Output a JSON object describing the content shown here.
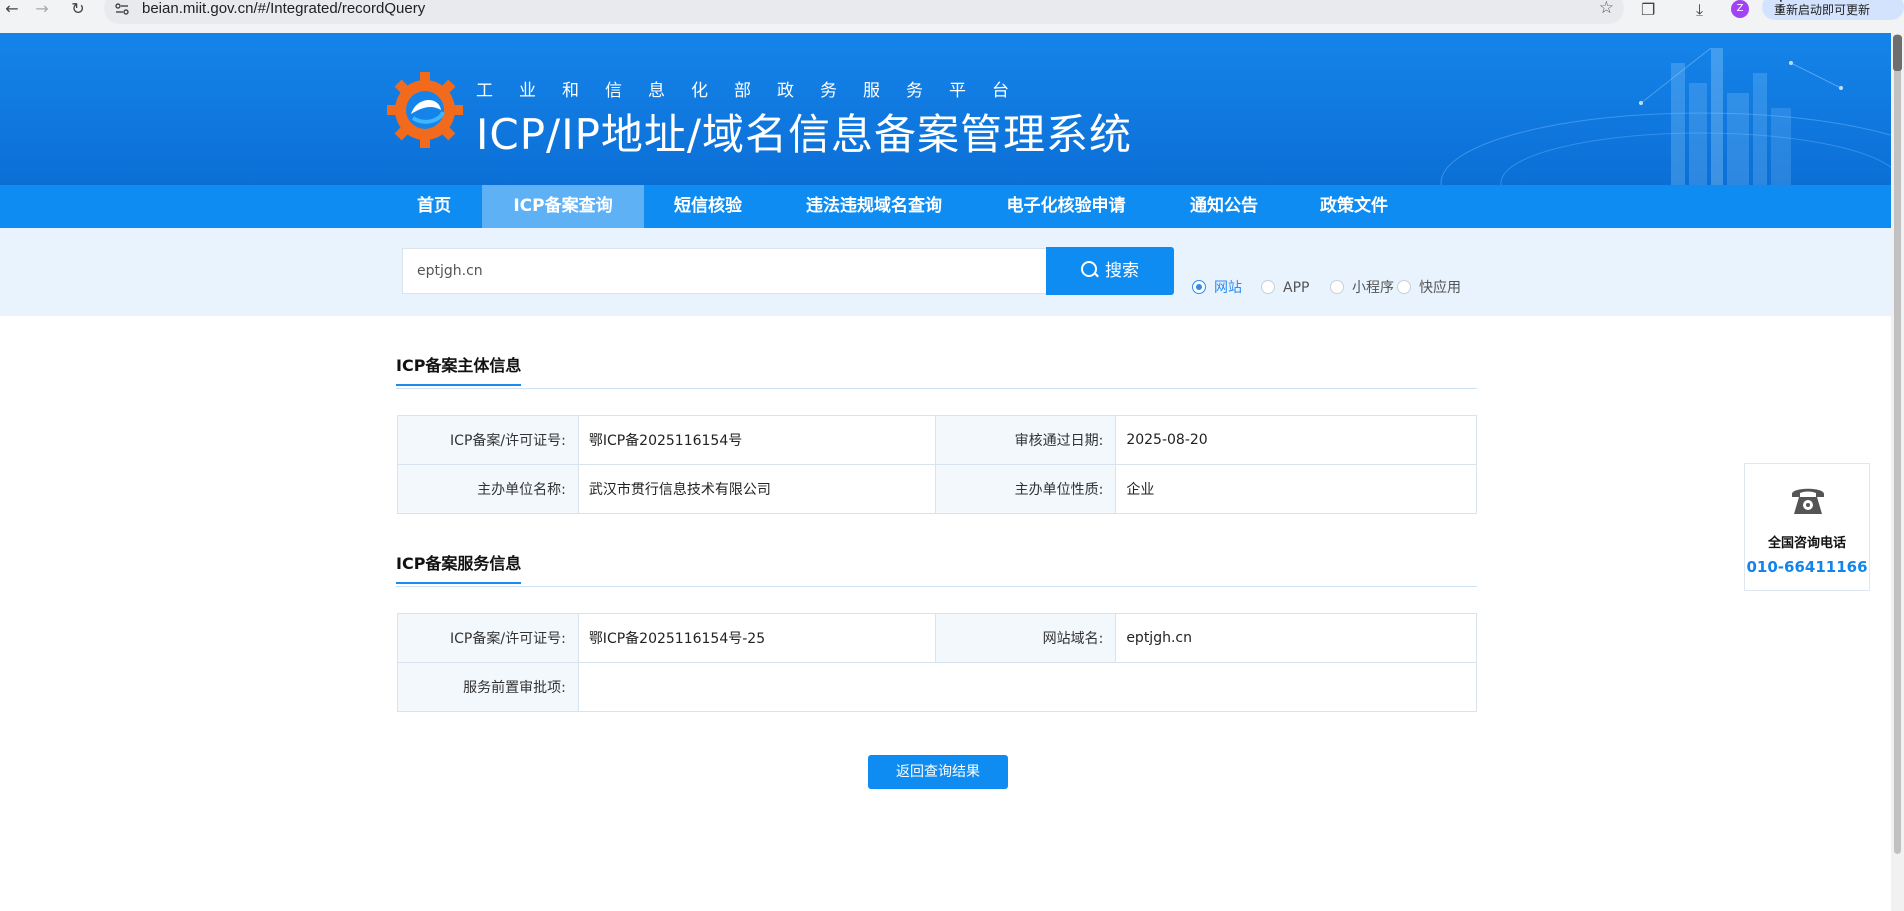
{
  "browser": {
    "url": "beian.miit.gov.cn/#/Integrated/recordQuery",
    "update_label": "重新启动即可更新",
    "avatar_letter": "Z"
  },
  "header": {
    "subtitle": "工业和信息化部政务服务平台",
    "title": "ICP/IP地址/域名信息备案管理系统"
  },
  "nav": {
    "items": [
      "首页",
      "ICP备案查询",
      "短信核验",
      "违法违规域名查询",
      "电子化核验申请",
      "通知公告",
      "政策文件"
    ],
    "active": "ICP备案查询"
  },
  "search": {
    "value": "eptjgh.cn",
    "button_label": "搜索",
    "types": [
      "网站",
      "APP",
      "小程序",
      "快应用"
    ],
    "selected_type": "网站"
  },
  "subject_section": {
    "title": "ICP备案主体信息",
    "rows": [
      {
        "label1": "ICP备案/许可证号:",
        "value1": "鄂ICP备2025116154号",
        "label2": "审核通过日期:",
        "value2": "2025-08-20"
      },
      {
        "label1": "主办单位名称:",
        "value1": "武汉市贯行信息技术有限公司",
        "label2": "主办单位性质:",
        "value2": "企业"
      }
    ]
  },
  "service_section": {
    "title": "ICP备案服务信息",
    "license_label": "ICP备案/许可证号:",
    "license_value": "鄂ICP备2025116154号-25",
    "domain_label": "网站域名:",
    "domain_value": "eptjgh.cn",
    "approval_label": "服务前置审批项:",
    "approval_value": ""
  },
  "back_button_label": "返回查询结果",
  "hotline": {
    "label": "全国咨询电话",
    "number": "010-66411166",
    "icon": "telephone-icon"
  },
  "colors": {
    "primary": "#0f8cf2",
    "nav_active": "#5fb1f6",
    "strip_bg": "#e8f3fd",
    "label_bg": "#f3f8fd"
  }
}
